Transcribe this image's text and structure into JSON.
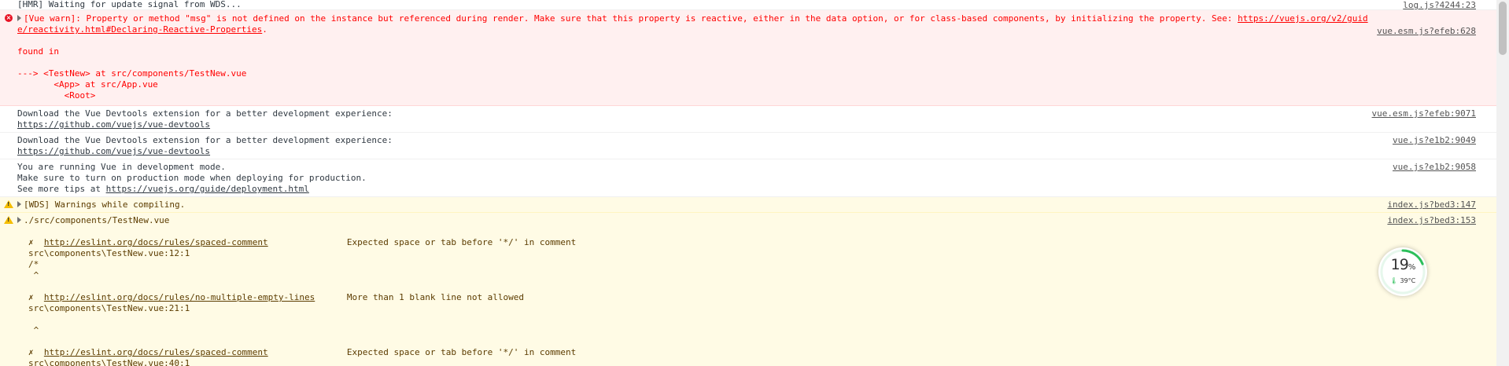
{
  "messages": {
    "hmr": {
      "text": "[HMR] Waiting for update signal from WDS...",
      "source": "log.js?4244:23"
    },
    "vue_warn": {
      "line1": "[Vue warn]: Property or method \"msg\" is not defined on the instance but referenced during render. Make sure that this property is reactive, either in the data option, or for class-based components, by initializing the property. See: ",
      "link_part1": "https://vuejs.org/v2/guid",
      "link_part2": "e/reactivity.html#Declaring-Reactive-Properties",
      "period": ".",
      "found_in": "found in",
      "trace1": "---> <TestNew> at src/components/TestNew.vue",
      "trace2": "       <App> at src/App.vue",
      "trace3": "         <Root>",
      "source": "vue.esm.js?efeb:628"
    },
    "devtools1": {
      "text": "Download the Vue Devtools extension for a better development experience:",
      "link": "https://github.com/vuejs/vue-devtools",
      "source": "vue.esm.js?efeb:9071"
    },
    "devtools2": {
      "text": "Download the Vue Devtools extension for a better development experience:",
      "link": "https://github.com/vuejs/vue-devtools",
      "source": "vue.js?e1b2:9049"
    },
    "devmode": {
      "line1": "You are running Vue in development mode.",
      "line2": "Make sure to turn on production mode when deploying for production.",
      "line3_prefix": "See more tips at ",
      "link": "https://vuejs.org/guide/deployment.html",
      "source": "vue.js?e1b2:9058"
    },
    "wds_warn": {
      "text": "[WDS] Warnings while compiling.",
      "source": "index.js?bed3:147"
    },
    "file_warn": {
      "text": "./src/components/TestNew.vue",
      "source": "index.js?bed3:153"
    },
    "lint": [
      {
        "mark": "✗",
        "url": "http://eslint.org/docs/rules/spaced-comment",
        "message": "Expected space or tab before '*/' in comment",
        "location": "src\\components\\TestNew.vue:12:1",
        "code": "/*",
        "caret": " ^"
      },
      {
        "mark": "✗",
        "url": "http://eslint.org/docs/rules/no-multiple-empty-lines",
        "message": "More than 1 blank line not allowed",
        "location": "src\\components\\TestNew.vue:21:1",
        "code": "",
        "caret": " ^"
      },
      {
        "mark": "✗",
        "url": "http://eslint.org/docs/rules/spaced-comment",
        "message": "Expected space or tab before '*/' in comment",
        "location": "src\\components\\TestNew.vue:40:1",
        "code": "",
        "caret": ""
      }
    ]
  },
  "gauge": {
    "value": "19",
    "unit": "%",
    "progress": 0.19,
    "temp": "39°C",
    "accent": "#2cbf5a"
  },
  "colors": {
    "error_bg": "#fff0f0",
    "warning_bg": "#fffbe5",
    "error_text": "#ff0000"
  },
  "icons": {
    "error": "error-circle-icon",
    "warning": "warning-triangle-icon",
    "expand": "expand-triangle-icon",
    "temp": "thermometer-icon"
  }
}
